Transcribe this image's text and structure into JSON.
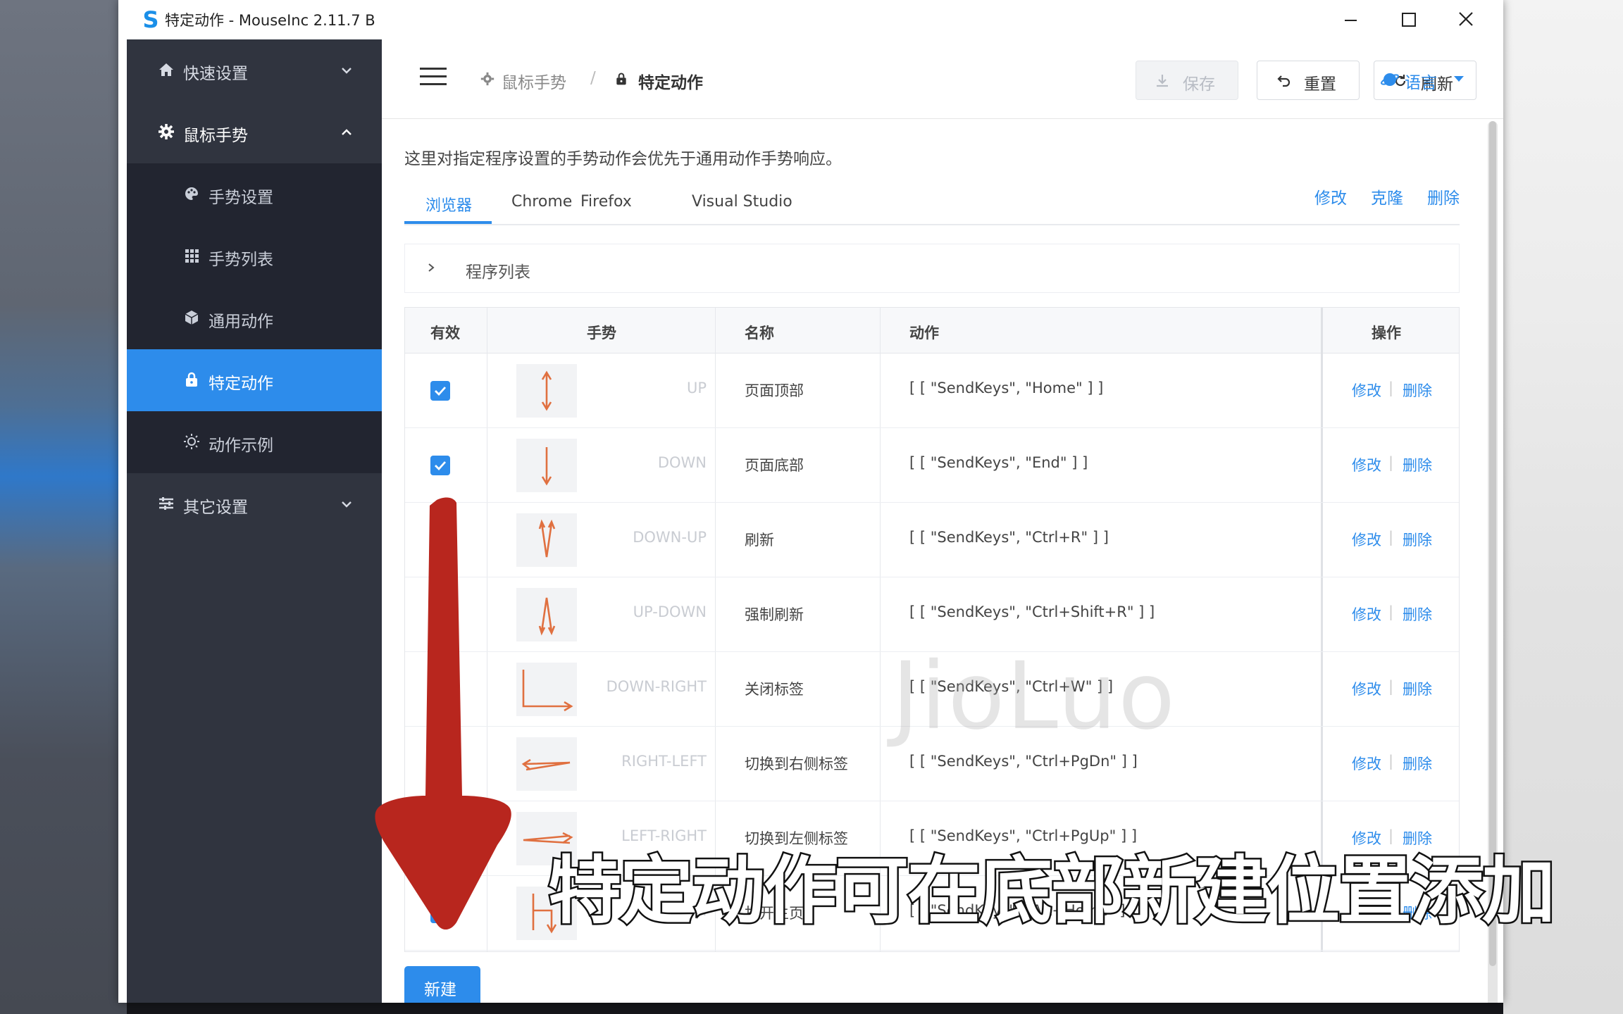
{
  "window": {
    "title": "特定动作 - MouseInc 2.11.7 B",
    "logo": "S"
  },
  "sidebar": {
    "items": [
      {
        "label": "快速设置",
        "icon": "home-icon"
      },
      {
        "label": "鼠标手势",
        "icon": "gear-icon"
      },
      {
        "label": "其它设置",
        "icon": "sliders-icon"
      }
    ],
    "sub_items": [
      {
        "label": "手势设置",
        "icon": "palette-icon"
      },
      {
        "label": "手势列表",
        "icon": "grid-icon"
      },
      {
        "label": "通用动作",
        "icon": "cube-icon"
      },
      {
        "label": "特定动作",
        "icon": "lock-icon",
        "active": true
      },
      {
        "label": "动作示例",
        "icon": "sun-icon"
      }
    ]
  },
  "header": {
    "breadcrumb": [
      "鼠标手势",
      "特定动作"
    ],
    "separator": "/",
    "save": "保存",
    "reset": "重置",
    "refresh": "刷新",
    "language": "语言"
  },
  "main": {
    "description": "这里对指定程序设置的手势动作会优先于通用动作手势响应。",
    "tabs": [
      "浏览器",
      "Chrome",
      "Firefox",
      "Visual Studio"
    ],
    "tab_actions": [
      "修改",
      "克隆",
      "删除"
    ],
    "collapse_label": "程序列表",
    "columns": [
      "有效",
      "手势",
      "名称",
      "动作",
      "操作"
    ],
    "rows": [
      {
        "gesture": "UP",
        "name": "页面顶部",
        "action": "[ [ \"SendKeys\", \"Home\" ] ]",
        "enabled": true
      },
      {
        "gesture": "DOWN",
        "name": "页面底部",
        "action": "[ [ \"SendKeys\", \"End\" ] ]",
        "enabled": true
      },
      {
        "gesture": "DOWN-UP",
        "name": "刷新",
        "action": "[ [ \"SendKeys\", \"Ctrl+R\" ] ]",
        "enabled": true
      },
      {
        "gesture": "UP-DOWN",
        "name": "强制刷新",
        "action": "[ [ \"SendKeys\", \"Ctrl+Shift+R\" ] ]",
        "enabled": true
      },
      {
        "gesture": "DOWN-RIGHT",
        "name": "关闭标签",
        "action": "[ [ \"SendKeys\", \"Ctrl+W\" ] ]",
        "enabled": true
      },
      {
        "gesture": "RIGHT-LEFT",
        "name": "切换到右侧标签",
        "action": "[ [ \"SendKeys\", \"Ctrl+PgDn\" ] ]",
        "enabled": true
      },
      {
        "gesture": "LEFT-RIGHT",
        "name": "切换到左侧标签",
        "action": "[ [ \"SendKeys\", \"Ctrl+PgUp\" ] ]",
        "enabled": true
      },
      {
        "gesture": "h",
        "name": "打开主页",
        "action": "[ [ \"SendKeys\", \"Alt+Home\" ] ]",
        "enabled": true
      }
    ],
    "row_edit": "修改",
    "row_delete": "删除",
    "row_separator": "|",
    "new_button": "新建"
  },
  "overlay": {
    "watermark": "JioLuo",
    "subtitle": "特定动作可在底部新建位置添加"
  },
  "colors": {
    "accent": "#2d8ceb",
    "sidebar": "#30343f",
    "gesture_stroke": "#e07040",
    "arrow": "#b8261e"
  }
}
